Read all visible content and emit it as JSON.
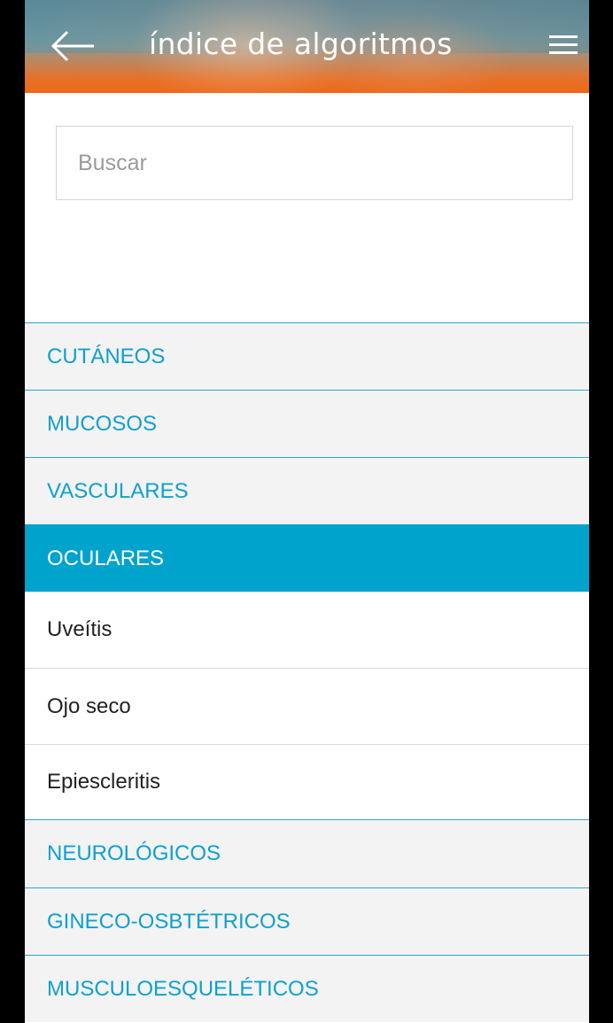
{
  "header": {
    "title": "índice de algoritmos",
    "back_icon": "arrow-left-icon",
    "menu_icon": "hamburger-menu-icon"
  },
  "search": {
    "placeholder": "Buscar",
    "value": ""
  },
  "colors": {
    "accent": "#00a3cc",
    "category_text": "#0fa0cf",
    "header_orange": "#ef6a1c"
  },
  "categories": [
    {
      "label": "CUTÁNEOS"
    },
    {
      "label": "MUCOSOS"
    },
    {
      "label": "VASCULARES"
    },
    {
      "label": "OCULARES",
      "expanded": true,
      "items": [
        "Uveítis",
        "Ojo seco",
        "Epiescleritis"
      ]
    },
    {
      "label": "NEUROLÓGICOS"
    },
    {
      "label": "GINECO-OSBTÉTRICOS"
    },
    {
      "label": "MUSCULOESQUELÉTICOS"
    }
  ]
}
